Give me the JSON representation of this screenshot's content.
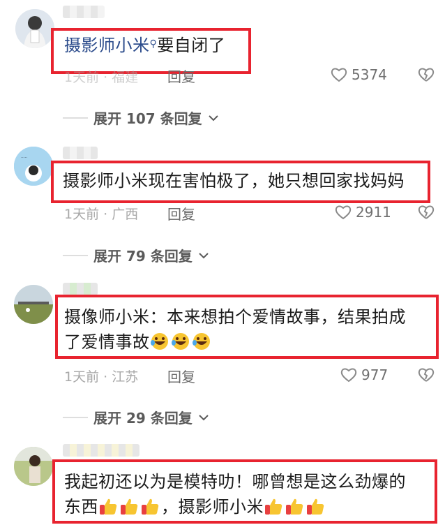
{
  "comments": [
    {
      "mention": "摄影师小米",
      "text": "要自闭了",
      "meta": "1天前 · 福建",
      "reply_label": "回复",
      "likes": "5374",
      "expand_label": "展开 107 条回复"
    },
    {
      "text": "摄影师小米现在害怕极了，她只想回家找妈妈",
      "meta": "1天前 · 广西",
      "reply_label": "回复",
      "likes": "2911",
      "expand_label": "展开 79 条回复"
    },
    {
      "line1": "摄像师小米：本来想拍个爱情故事，结果拍成",
      "line2": "了爱情事故",
      "emoji": [
        "rofl-emoji",
        "rofl-emoji",
        "rofl-emoji"
      ],
      "meta": "1天前 · 江苏",
      "reply_label": "回复",
      "likes": "977",
      "expand_label": "展开 29 条回复"
    },
    {
      "line1": "我起初还以为是模特叻！哪曾想是这么劲爆的",
      "line2a": "东西",
      "line2b": "，摄影师小米",
      "emoji": [
        "thumbs-up-emoji",
        "thumbs-up-emoji",
        "thumbs-up-emoji"
      ]
    }
  ],
  "colors": {
    "highlight_box": "#e8232f",
    "mention": "#2c4c8c"
  }
}
